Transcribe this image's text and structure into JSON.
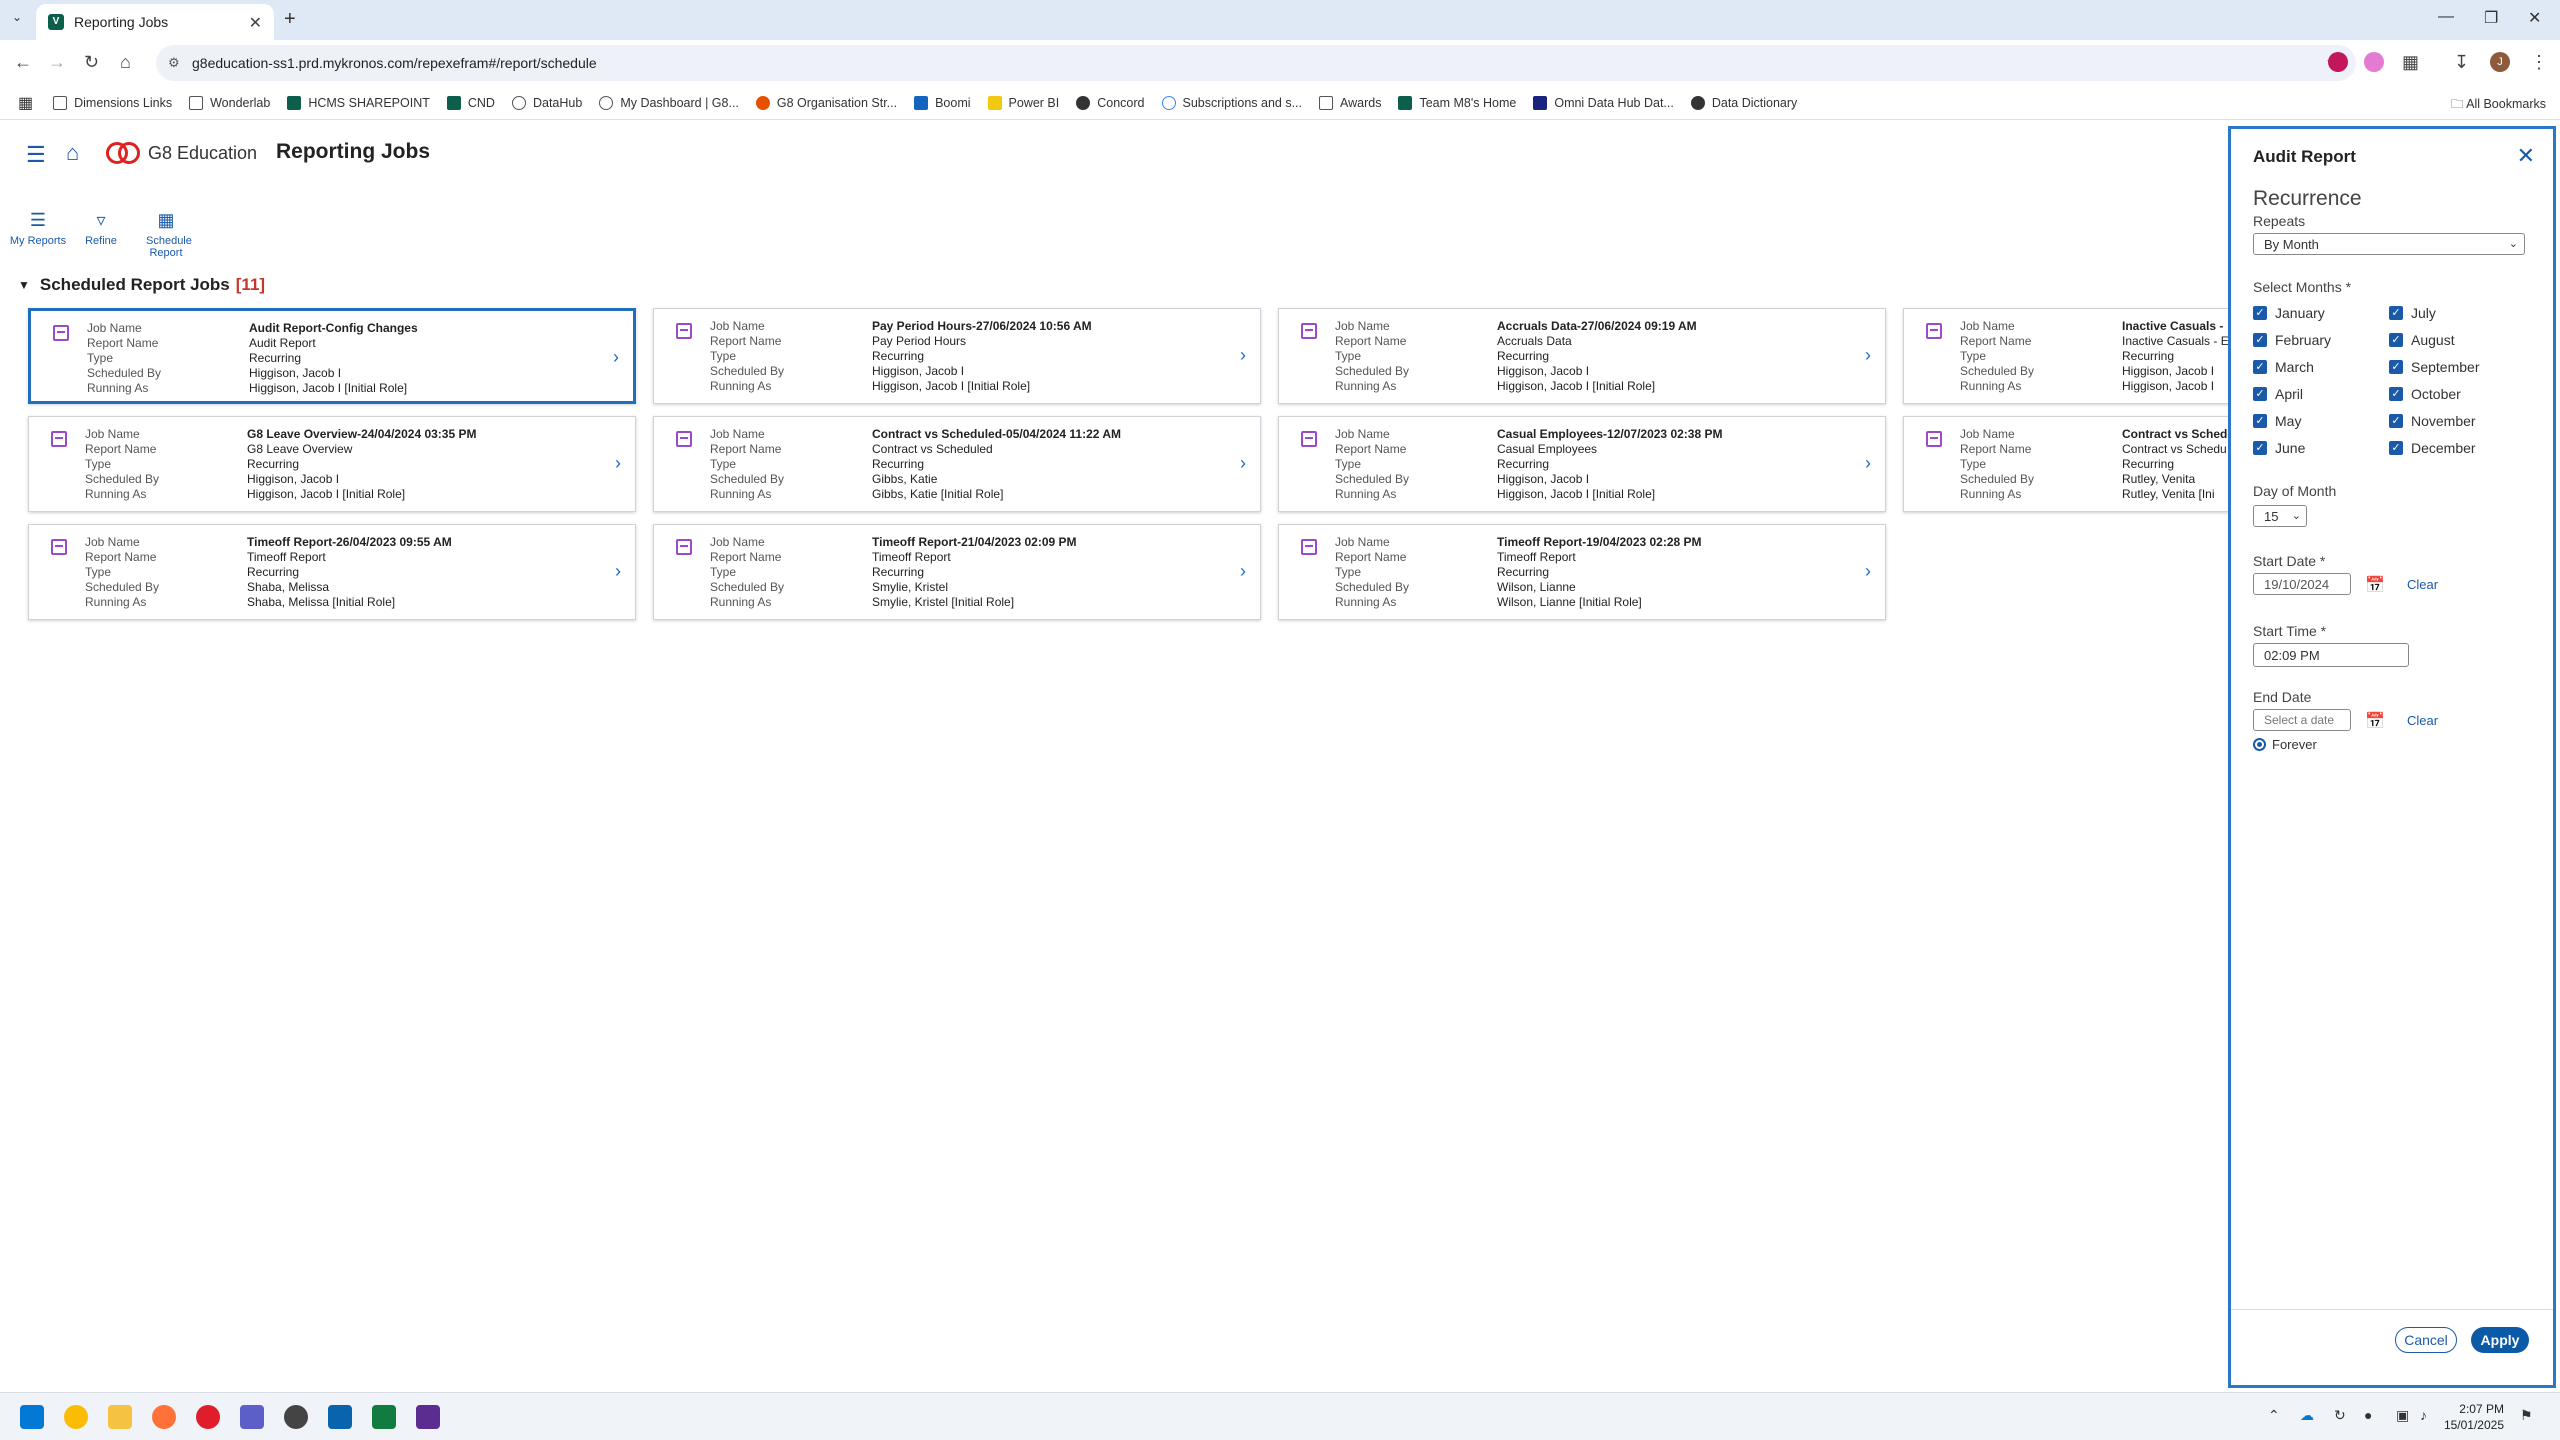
{
  "browser": {
    "tab_title": "Reporting Jobs",
    "url": "g8education-ss1.prd.mykronos.com/repexefram#/report/schedule",
    "bookmarks": [
      "Dimensions Links",
      "Wonderlab",
      "HCMS SHAREPOINT",
      "CND",
      "DataHub",
      "My Dashboard | G8...",
      "G8 Organisation Str...",
      "Boomi",
      "Power BI",
      "Concord",
      "Subscriptions and s...",
      "Awards",
      "Team M8's Home",
      "Omni Data Hub Dat...",
      "Data Dictionary"
    ],
    "all_bookmarks": "All Bookmarks",
    "profile_initial": "J"
  },
  "app": {
    "logo_text": "G8 Education",
    "title": "Reporting Jobs",
    "toolbar": [
      {
        "label": "My Reports"
      },
      {
        "label": "Refine"
      },
      {
        "label": "Schedule Report"
      }
    ],
    "section_title": "Scheduled Report Jobs",
    "section_count": "[11]",
    "field_labels": [
      "Job Name",
      "Report Name",
      "Type",
      "Scheduled By",
      "Running As"
    ],
    "jobs": [
      {
        "job": "Audit Report-Config Changes",
        "report": "Audit Report",
        "type": "Recurring",
        "by": "Higgison, Jacob I",
        "as": "Higgison, Jacob I [Initial Role]"
      },
      {
        "job": "Pay Period Hours-27/06/2024 10:56 AM",
        "report": "Pay Period Hours",
        "type": "Recurring",
        "by": "Higgison, Jacob I",
        "as": "Higgison, Jacob I [Initial Role]"
      },
      {
        "job": "Accruals Data-27/06/2024 09:19 AM",
        "report": "Accruals Data",
        "type": "Recurring",
        "by": "Higgison, Jacob I",
        "as": "Higgison, Jacob I [Initial Role]"
      },
      {
        "job": "Inactive Casuals -",
        "report": "Inactive Casuals - E",
        "type": "Recurring",
        "by": "Higgison, Jacob I",
        "as": "Higgison, Jacob I"
      },
      {
        "job": "G8 Leave Overview-24/04/2024 03:35 PM",
        "report": "G8 Leave Overview",
        "type": "Recurring",
        "by": "Higgison, Jacob I",
        "as": "Higgison, Jacob I [Initial Role]"
      },
      {
        "job": "Contract vs Scheduled-05/04/2024 11:22 AM",
        "report": "Contract vs Scheduled",
        "type": "Recurring",
        "by": "Gibbs, Katie",
        "as": "Gibbs, Katie [Initial Role]"
      },
      {
        "job": "Casual Employees-12/07/2023 02:38 PM",
        "report": "Casual Employees",
        "type": "Recurring",
        "by": "Higgison, Jacob I",
        "as": "Higgison, Jacob I [Initial Role]"
      },
      {
        "job": "Contract vs Sched",
        "report": "Contract vs Schedu",
        "type": "Recurring",
        "by": "Rutley, Venita",
        "as": "Rutley, Venita [Ini"
      },
      {
        "job": "Timeoff Report-26/04/2023 09:55 AM",
        "report": "Timeoff Report",
        "type": "Recurring",
        "by": "Shaba, Melissa",
        "as": "Shaba, Melissa [Initial Role]"
      },
      {
        "job": "Timeoff Report-21/04/2023 02:09 PM",
        "report": "Timeoff Report",
        "type": "Recurring",
        "by": "Smylie, Kristel",
        "as": "Smylie, Kristel [Initial Role]"
      },
      {
        "job": "Timeoff Report-19/04/2023 02:28 PM",
        "report": "Timeoff Report",
        "type": "Recurring",
        "by": "Wilson, Lianne",
        "as": "Wilson, Lianne [Initial Role]"
      }
    ]
  },
  "panel": {
    "title": "Audit Report",
    "recurrence": "Recurrence",
    "repeats_label": "Repeats",
    "repeats_value": "By Month",
    "months_label": "Select Months *",
    "months": [
      "January",
      "February",
      "March",
      "April",
      "May",
      "June",
      "July",
      "August",
      "September",
      "October",
      "November",
      "December"
    ],
    "day_label": "Day of Month",
    "day_value": "15",
    "start_date_label": "Start Date *",
    "start_date": "19/10/2024",
    "clear": "Clear",
    "start_time_label": "Start Time *",
    "start_time": "02:09 PM",
    "end_date_label": "End Date",
    "end_date_placeholder": "Select a date",
    "forever": "Forever",
    "cancel": "Cancel",
    "apply": "Apply"
  },
  "taskbar": {
    "time": "2:07 PM",
    "date": "15/01/2025"
  },
  "colors": {
    "accent": "#1a5aa8",
    "count_red": "#c0392b",
    "card_icon": "#9c4ac9"
  }
}
